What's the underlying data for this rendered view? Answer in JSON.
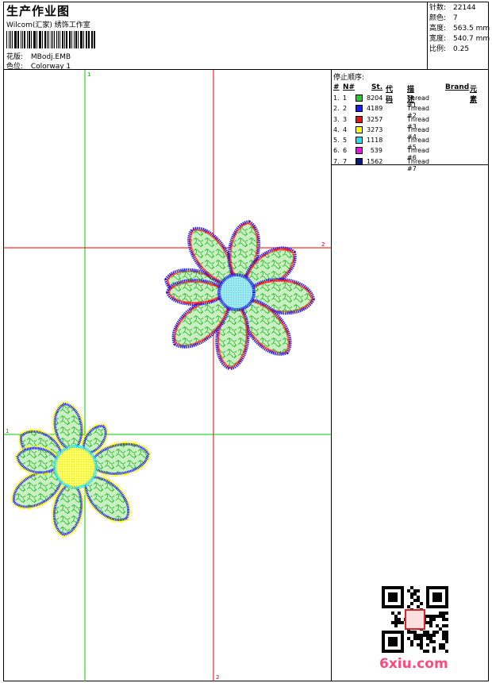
{
  "header": {
    "title": "生产作业图",
    "subtitle": "Wilcom(汇家) 绣饰工作室",
    "design_label": "花版:",
    "design_value": "MBodj.EMB",
    "colorway_label": "色位:",
    "colorway_value": "Colorway 1"
  },
  "stats": [
    {
      "label": "针数:",
      "value": "22144"
    },
    {
      "label": "颜色:",
      "value": "7"
    },
    {
      "label": "高度:",
      "value": "563.5 mm"
    },
    {
      "label": "宽度:",
      "value": "540.7 mm"
    },
    {
      "label": "比例:",
      "value": "0.25"
    }
  ],
  "threads": {
    "label": "停止顺序:",
    "columns": {
      "stop": "#",
      "num": "N#",
      "st": "St.",
      "code": "代码",
      "desc": "描述",
      "brand": "Brand",
      "element": "元素"
    },
    "rows": [
      {
        "stop": "1.",
        "num": "1",
        "color": "#22cc22",
        "code": "8204",
        "desc": "Thread #1"
      },
      {
        "stop": "2.",
        "num": "2",
        "color": "#1a1aff",
        "code": "4189",
        "desc": "Thread #2"
      },
      {
        "stop": "3.",
        "num": "3",
        "color": "#ee1111",
        "code": "3257",
        "desc": "Thread #3"
      },
      {
        "stop": "4.",
        "num": "4",
        "color": "#ffff00",
        "code": "3273",
        "desc": "Thread #4"
      },
      {
        "stop": "5.",
        "num": "5",
        "color": "#22e0ee",
        "code": "1118",
        "desc": "Thread #5"
      },
      {
        "stop": "6.",
        "num": "6",
        "color": "#ee11ee",
        "code": "539",
        "desc": "Thread #6"
      },
      {
        "stop": "7.",
        "num": "7",
        "color": "#0a1a80",
        "code": "1562",
        "desc": "Thread #7"
      }
    ]
  },
  "guides": {
    "v1": "1",
    "h2": "2",
    "v2": "2",
    "h1": "1"
  },
  "watermark": "6xiu.com",
  "colors": {
    "guide_green": "#00cc00",
    "guide_red": "#ee0000",
    "fill_green": "#c9efc3",
    "fill_cyan": "#9ee8f0",
    "fill_yellow": "#ffff55"
  }
}
